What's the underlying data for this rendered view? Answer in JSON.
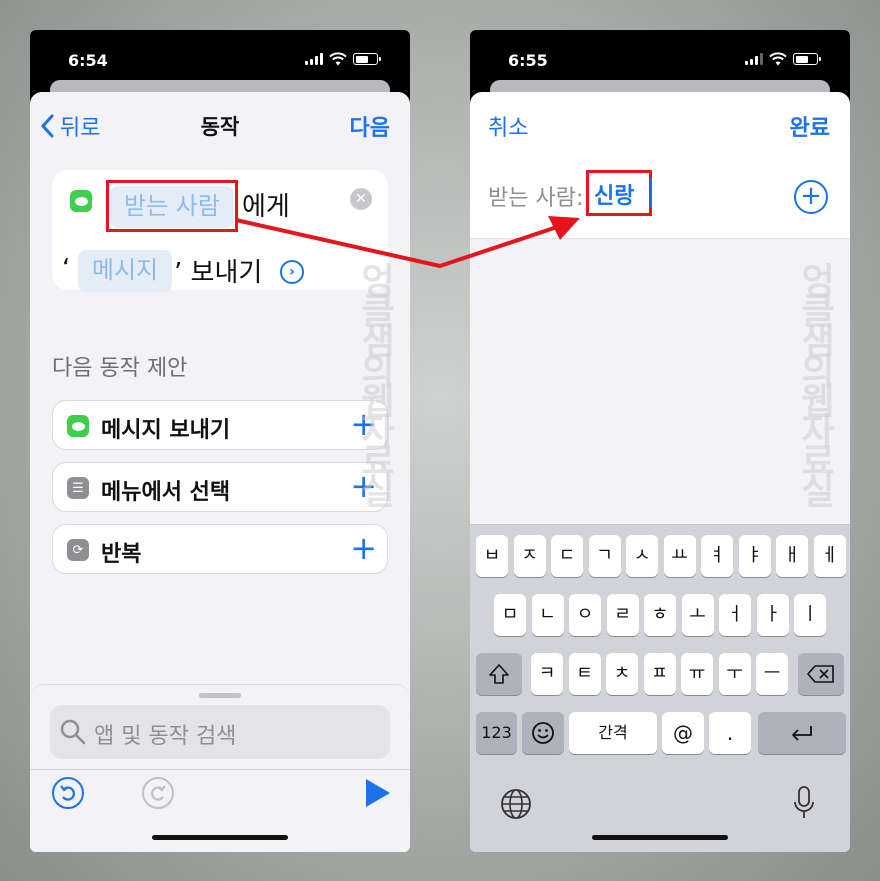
{
  "left_phone": {
    "status": {
      "time": "6:54"
    },
    "nav": {
      "back_label": "뒤로",
      "title": "동작",
      "next_label": "다음"
    },
    "action_card": {
      "recipient_placeholder": "받는 사람",
      "to_suffix": "에게",
      "quote_open": "‘",
      "message_placeholder": "메시지",
      "quote_close_send": "’ 보내기"
    },
    "suggestions": {
      "title": "다음 동작 제안",
      "items": [
        {
          "label": "메시지 보내기",
          "icon": "messages-icon"
        },
        {
          "label": "메뉴에서 선택",
          "icon": "menu-icon"
        },
        {
          "label": "반복",
          "icon": "repeat-icon"
        }
      ]
    },
    "search": {
      "placeholder": "앱 및 동작 검색"
    }
  },
  "right_phone": {
    "status": {
      "time": "6:55"
    },
    "nav": {
      "cancel_label": "취소",
      "done_label": "완료"
    },
    "to_field": {
      "label": "받는 사람:",
      "value": "신랑"
    },
    "keyboard": {
      "row1": [
        "ㅂ",
        "ㅈ",
        "ㄷ",
        "ㄱ",
        "ㅅ",
        "ㅛ",
        "ㅕ",
        "ㅑ",
        "ㅐ",
        "ㅔ"
      ],
      "row2": [
        "ㅁ",
        "ㄴ",
        "ㅇ",
        "ㄹ",
        "ㅎ",
        "ㅗ",
        "ㅓ",
        "ㅏ",
        "ㅣ"
      ],
      "row3": [
        "ㅋ",
        "ㅌ",
        "ㅊ",
        "ㅍ",
        "ㅠ",
        "ㅜ",
        "ㅡ"
      ],
      "numbers_key": "123",
      "space_key": "간격",
      "at_key": "@",
      "period_key": "."
    }
  },
  "watermark": "엉클샘의웹자료실",
  "colors": {
    "accent": "#1a73e8",
    "highlight_box": "#e8141b",
    "messages_green": "#3ecf4c"
  }
}
